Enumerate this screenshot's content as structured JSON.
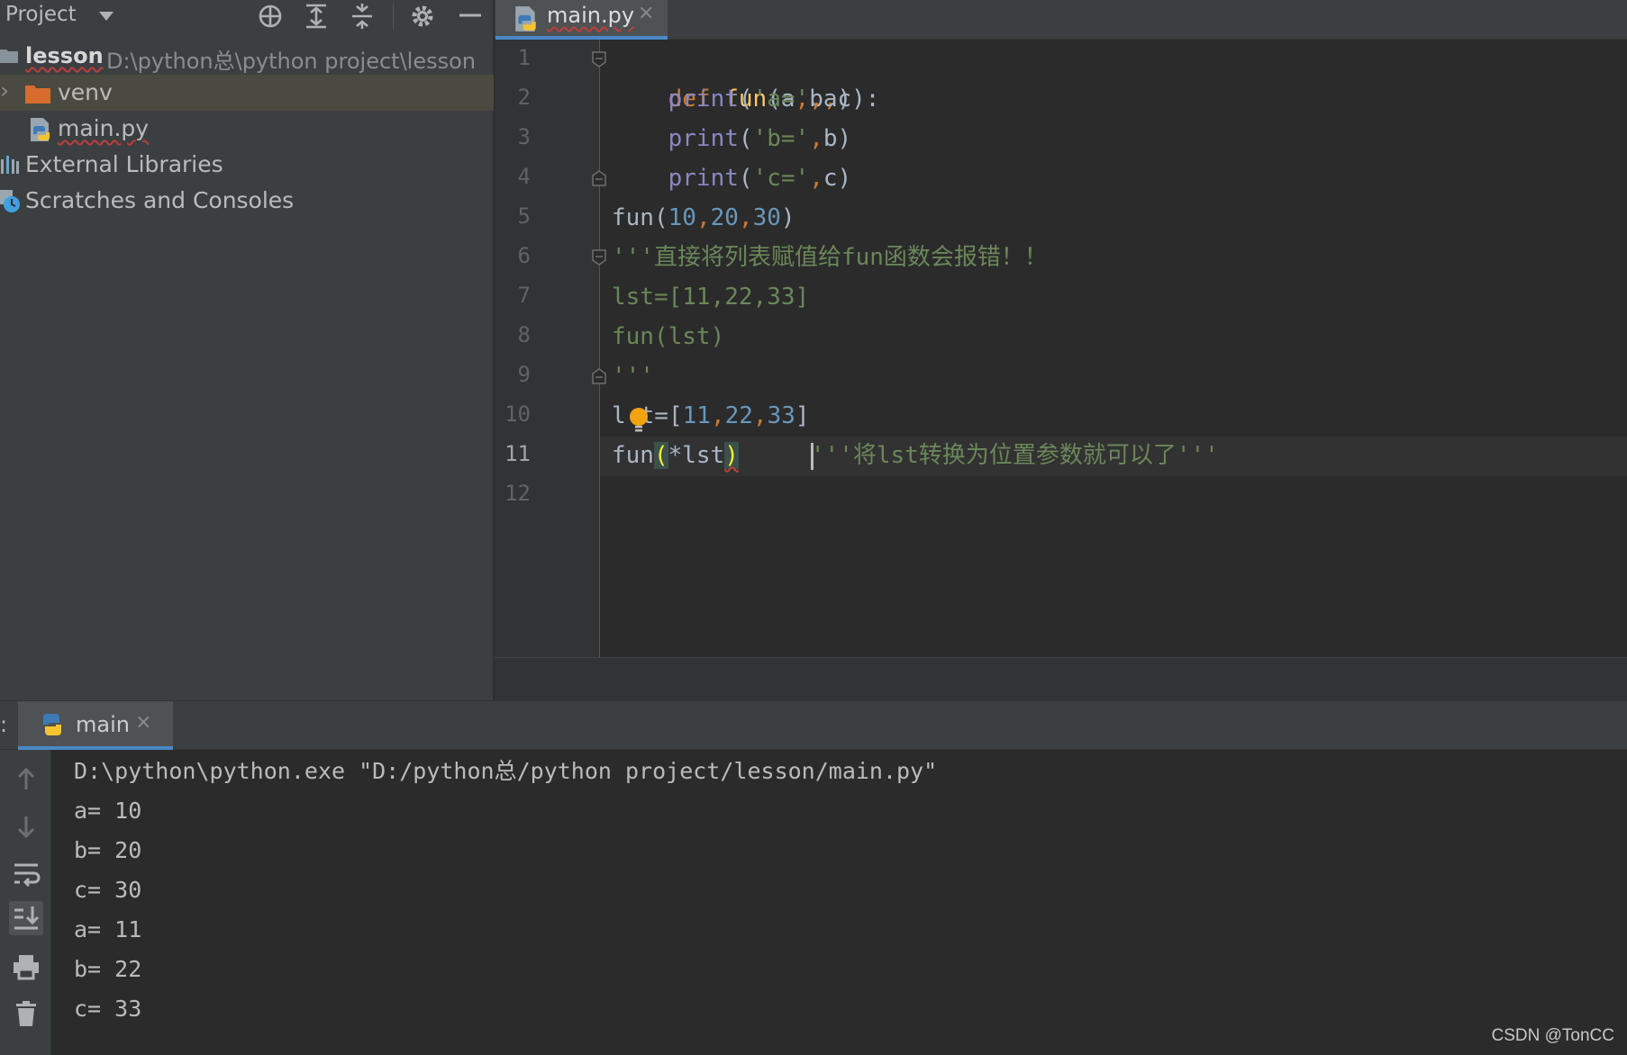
{
  "project_panel": {
    "title": "Project",
    "toolbar_icons": [
      "locate-icon",
      "expand-all-icon",
      "collapse-all-icon",
      "gear-icon",
      "minimize-icon"
    ],
    "tree": [
      {
        "label": "lesson",
        "path": "D:\\python总\\python project\\lesson",
        "icon": "folder-icon"
      },
      {
        "label": "venv",
        "icon": "folder-icon",
        "expander": "›"
      },
      {
        "label": "main.py",
        "icon": "python-file-icon"
      },
      {
        "label": "External Libraries",
        "icon": "library-icon"
      },
      {
        "label": "Scratches and Consoles",
        "icon": "scratches-icon"
      }
    ]
  },
  "editor": {
    "tab": {
      "label": "main.py",
      "close": "×"
    },
    "line_numbers": [
      "1",
      "2",
      "3",
      "4",
      "5",
      "6",
      "7",
      "8",
      "9",
      "10",
      "11",
      "12"
    ],
    "current_line": 11,
    "code": {
      "l1": {
        "kw": "def",
        "name": "fun",
        "open": "(a",
        "c1": ",",
        "b": "b",
        "c2": ",",
        "close": "c):"
      },
      "l2": {
        "fn": "print",
        "open": "(",
        "str": "'a='",
        "comma": ",",
        "rest": "a)"
      },
      "l3": {
        "fn": "print",
        "open": "(",
        "str": "'b='",
        "comma": ",",
        "rest": "b)"
      },
      "l4": {
        "fn": "print",
        "open": "(",
        "str": "'c='",
        "comma": ",",
        "rest": "c)"
      },
      "l5": {
        "fn": "fun(",
        "n1": "10",
        "c1": ",",
        "n2": "20",
        "c2": ",",
        "n3": "30",
        "close": ")"
      },
      "l6": "'''直接将列表赋值给fun函数会报错！！",
      "l7": "lst=[11,22,33]",
      "l8": "fun(lst)",
      "l9": "'''",
      "l10": {
        "a": "l",
        "b": "t=[",
        "n1": "11",
        "c1": ",",
        "n2": "22",
        "c2": ",",
        "n3": "33",
        "close": "]"
      },
      "l11": {
        "fn": "fun",
        "open": "(",
        "star": "*lst",
        "close": ")",
        "comment": "'''将lst转换为位置参数就可以了'''"
      }
    }
  },
  "run_panel": {
    "colon": ":",
    "tab": {
      "label": "main",
      "close": "×"
    },
    "sidebar_icons": [
      "arrow-up-icon",
      "arrow-down-icon",
      "soft-wrap-icon",
      "scroll-to-end-icon",
      "print-icon",
      "trash-icon"
    ],
    "console": [
      "D:\\python\\python.exe \"D:/python总/python project/lesson/main.py\"",
      "a= 10",
      "b= 20",
      "c= 30",
      "a= 11",
      "b= 22",
      "c= 33"
    ]
  },
  "watermark": "CSDN @TonCC",
  "colors": {
    "keyword": "#cc7832",
    "function": "#ffc66d",
    "builtin": "#8888c6",
    "string": "#6a8759",
    "number": "#6897bb",
    "accent": "#4a88c7"
  }
}
